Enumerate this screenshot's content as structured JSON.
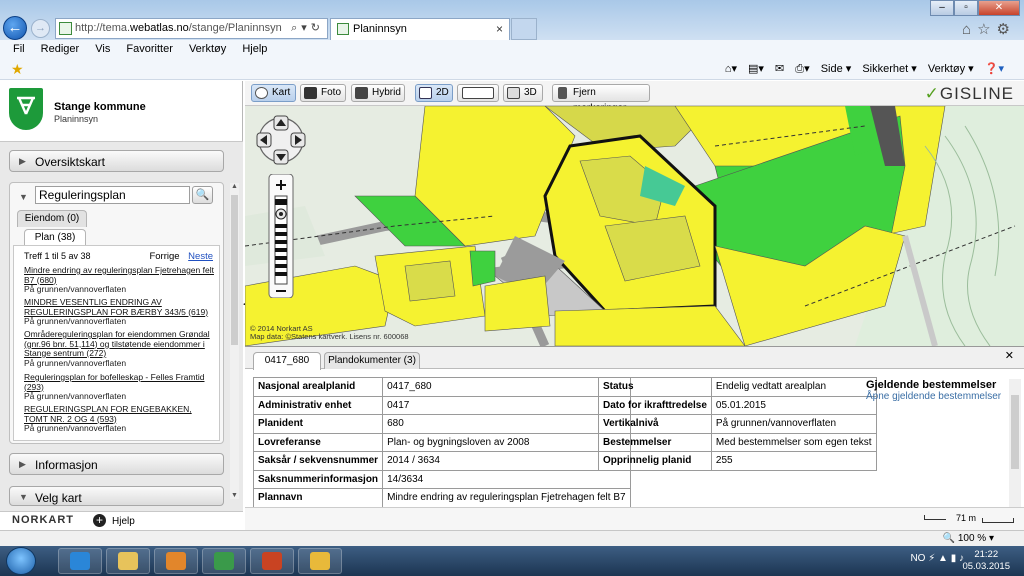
{
  "browser": {
    "url_prefix": "http://tema.",
    "url_domain": "webatlas.no",
    "url_path": "/stange/Planinnsyn",
    "tab_title": "Planinnsyn",
    "menu": [
      "Fil",
      "Rediger",
      "Vis",
      "Favoritter",
      "Verktøy",
      "Hjelp"
    ],
    "command_bar": [
      "Side ▾",
      "Sikkerhet ▾",
      "Verktøy ▾"
    ]
  },
  "sidebar": {
    "title": "Stange kommune",
    "subtitle": "Planinnsyn",
    "oversiktskart_label": "Oversiktskart",
    "reguleringsplan_value": "Reguleringsplan",
    "tabs": {
      "eiendom": "Eiendom (0)",
      "plan": "Plan (38)"
    },
    "results_count": "Treff 1 til 5 av 38",
    "prev_label": "Forrige",
    "next_label": "Neste",
    "results": [
      {
        "title": "Mindre endring av reguleringsplan Fjetrehagen felt B7 (680)",
        "sub": "På grunnen/vannoverflaten"
      },
      {
        "title": "MINDRE VESENTLIG ENDRING AV REGULERINGSPLAN FOR BÆRBY 343/5 (619)",
        "sub": "På grunnen/vannoverflaten"
      },
      {
        "title": "Områdereguleringsplan for eiendommen Grøndal (gnr.96 bnr. 51,114) og tilstøtende eiendommer i Stange sentrum (272)",
        "sub": "På grunnen/vannoverflaten"
      },
      {
        "title": "Reguleringsplan for bofelleskap - Felles Framtid (293)",
        "sub": "På grunnen/vannoverflaten"
      },
      {
        "title": "REGULERINGSPLAN FOR ENGEBAKKEN, TOMT NR. 2 OG 4 (593)",
        "sub": "På grunnen/vannoverflaten"
      }
    ],
    "informasjon_label": "Informasjon",
    "velg_kart_label": "Velg kart",
    "footer_brand": "NORKART",
    "help_label": "Hjelp"
  },
  "map_toolbar": {
    "kart": "Kart",
    "foto": "Foto",
    "hybrid": "Hybrid",
    "view_2d": "2D",
    "view_3d": "3D",
    "clear": "Fjern markeringer",
    "brand": "GISLINE"
  },
  "map": {
    "copyright_line1": "© 2014 Norkart AS",
    "copyright_line2": "Map data: ©Statens kartverk. Lisens nr. 600068"
  },
  "info": {
    "tab_id": "0417_680",
    "tab_docs": "Plandokumenter (3)",
    "left_rows": [
      {
        "key": "Nasjonal arealplanid",
        "value": "0417_680"
      },
      {
        "key": "Administrativ enhet",
        "value": "0417"
      },
      {
        "key": "Planident",
        "value": "680"
      },
      {
        "key": "Lovreferanse",
        "value": "Plan- og bygningsloven av 2008"
      },
      {
        "key": "Saksår / sekvensnummer",
        "value": "2014 / 3634"
      },
      {
        "key": "Saksnummerinformasjon",
        "value": "14/3634"
      },
      {
        "key": "Plannavn",
        "value": "Mindre endring av reguleringsplan Fjetrehagen felt B7"
      }
    ],
    "right_rows": [
      {
        "key": "Status",
        "value": "Endelig vedtatt arealplan"
      },
      {
        "key": "Dato for ikrafttredelse",
        "value": "05.01.2015"
      },
      {
        "key": "Vertikalnivå",
        "value": "På grunnen/vannoverflaten"
      },
      {
        "key": "Bestemmelser",
        "value": "Med bestemmelser som egen tekst"
      },
      {
        "key": "Opprinnelig planid",
        "value": "255"
      }
    ],
    "gjeldende_title": "Gjeldende bestemmelser",
    "gjeldende_link": "Åpne gjeldende bestemmelser",
    "scale_label": "71 m"
  },
  "status": {
    "zoom": "100 %"
  },
  "taskbar": {
    "lang": "NO",
    "time": "21:22",
    "date": "05.03.2015"
  },
  "colors": {
    "brand_green": "#1d9a3a",
    "link_blue": "#2050c0",
    "map_yellow": "#f2ee3a",
    "map_green": "#3fd13f"
  }
}
